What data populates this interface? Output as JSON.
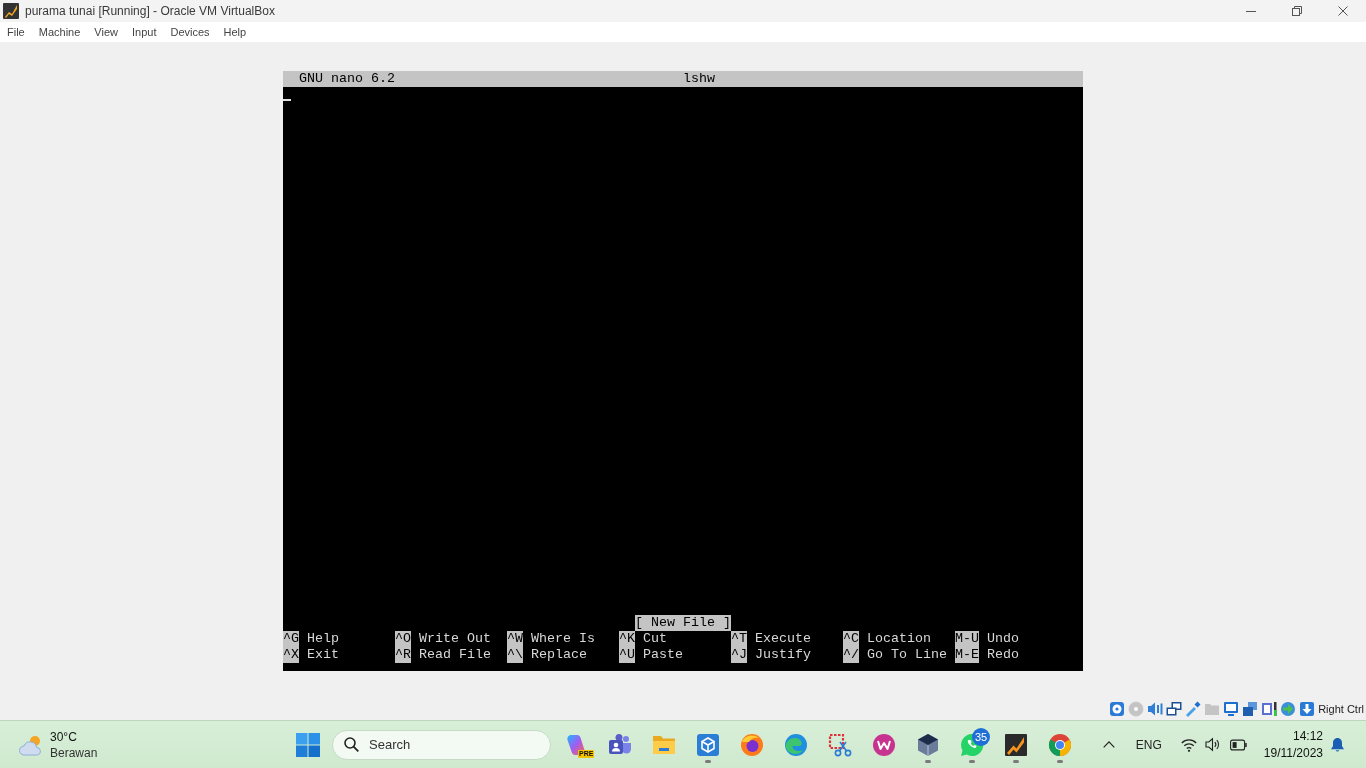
{
  "window": {
    "title": "purama tunai [Running] - Oracle VM VirtualBox"
  },
  "menu": [
    "File",
    "Machine",
    "View",
    "Input",
    "Devices",
    "Help"
  ],
  "nano": {
    "version": "GNU nano 6.2",
    "filename": "lshw",
    "status": "[ New File ]",
    "shortcut_rows": [
      [
        {
          "key": "^G",
          "label": "Help"
        },
        {
          "key": "^O",
          "label": "Write Out"
        },
        {
          "key": "^W",
          "label": "Where Is"
        },
        {
          "key": "^K",
          "label": "Cut"
        },
        {
          "key": "^T",
          "label": "Execute"
        },
        {
          "key": "^C",
          "label": "Location"
        },
        {
          "key": "M-U",
          "label": "Undo"
        }
      ],
      [
        {
          "key": "^X",
          "label": "Exit"
        },
        {
          "key": "^R",
          "label": "Read File"
        },
        {
          "key": "^\\",
          "label": "Replace"
        },
        {
          "key": "^U",
          "label": "Paste"
        },
        {
          "key": "^J",
          "label": "Justify"
        },
        {
          "key": "^/",
          "label": "Go To Line"
        },
        {
          "key": "M-E",
          "label": "Redo"
        }
      ]
    ]
  },
  "status_bar": {
    "indicators": [
      {
        "kind": "disk",
        "active": true
      },
      {
        "kind": "optical",
        "active": false
      },
      {
        "kind": "audio",
        "active": true
      },
      {
        "kind": "network",
        "active": true
      },
      {
        "kind": "usb",
        "active": true
      },
      {
        "kind": "shared-folder",
        "active": false
      },
      {
        "kind": "display",
        "active": true
      },
      {
        "kind": "capture",
        "active": true
      },
      {
        "kind": "cpu",
        "active": true
      },
      {
        "kind": "mouse",
        "active": true
      },
      {
        "kind": "keyboard",
        "active": true
      }
    ],
    "host_key": "Right Ctrl"
  },
  "taskbar": {
    "weather": {
      "temperature": "30°C",
      "condition": "Berawan"
    },
    "search": {
      "placeholder": "Search"
    },
    "apps": [
      {
        "kind": "sparkle",
        "tag": "PRE",
        "running": false
      },
      {
        "kind": "people",
        "running": false
      },
      {
        "kind": "folder",
        "running": false
      },
      {
        "kind": "cube",
        "running": true
      },
      {
        "kind": "fox",
        "running": false
      },
      {
        "kind": "swirl",
        "running": false
      },
      {
        "kind": "scissors",
        "running": false
      },
      {
        "kind": "zigzag",
        "running": false
      },
      {
        "kind": "box",
        "running": true
      },
      {
        "kind": "chat",
        "badge": "35",
        "running": true
      },
      {
        "kind": "slash",
        "running": true
      },
      {
        "kind": "wheel",
        "running": true
      }
    ],
    "tray": {
      "language": "ENG",
      "time": "14:12",
      "date": "19/11/2023"
    }
  }
}
